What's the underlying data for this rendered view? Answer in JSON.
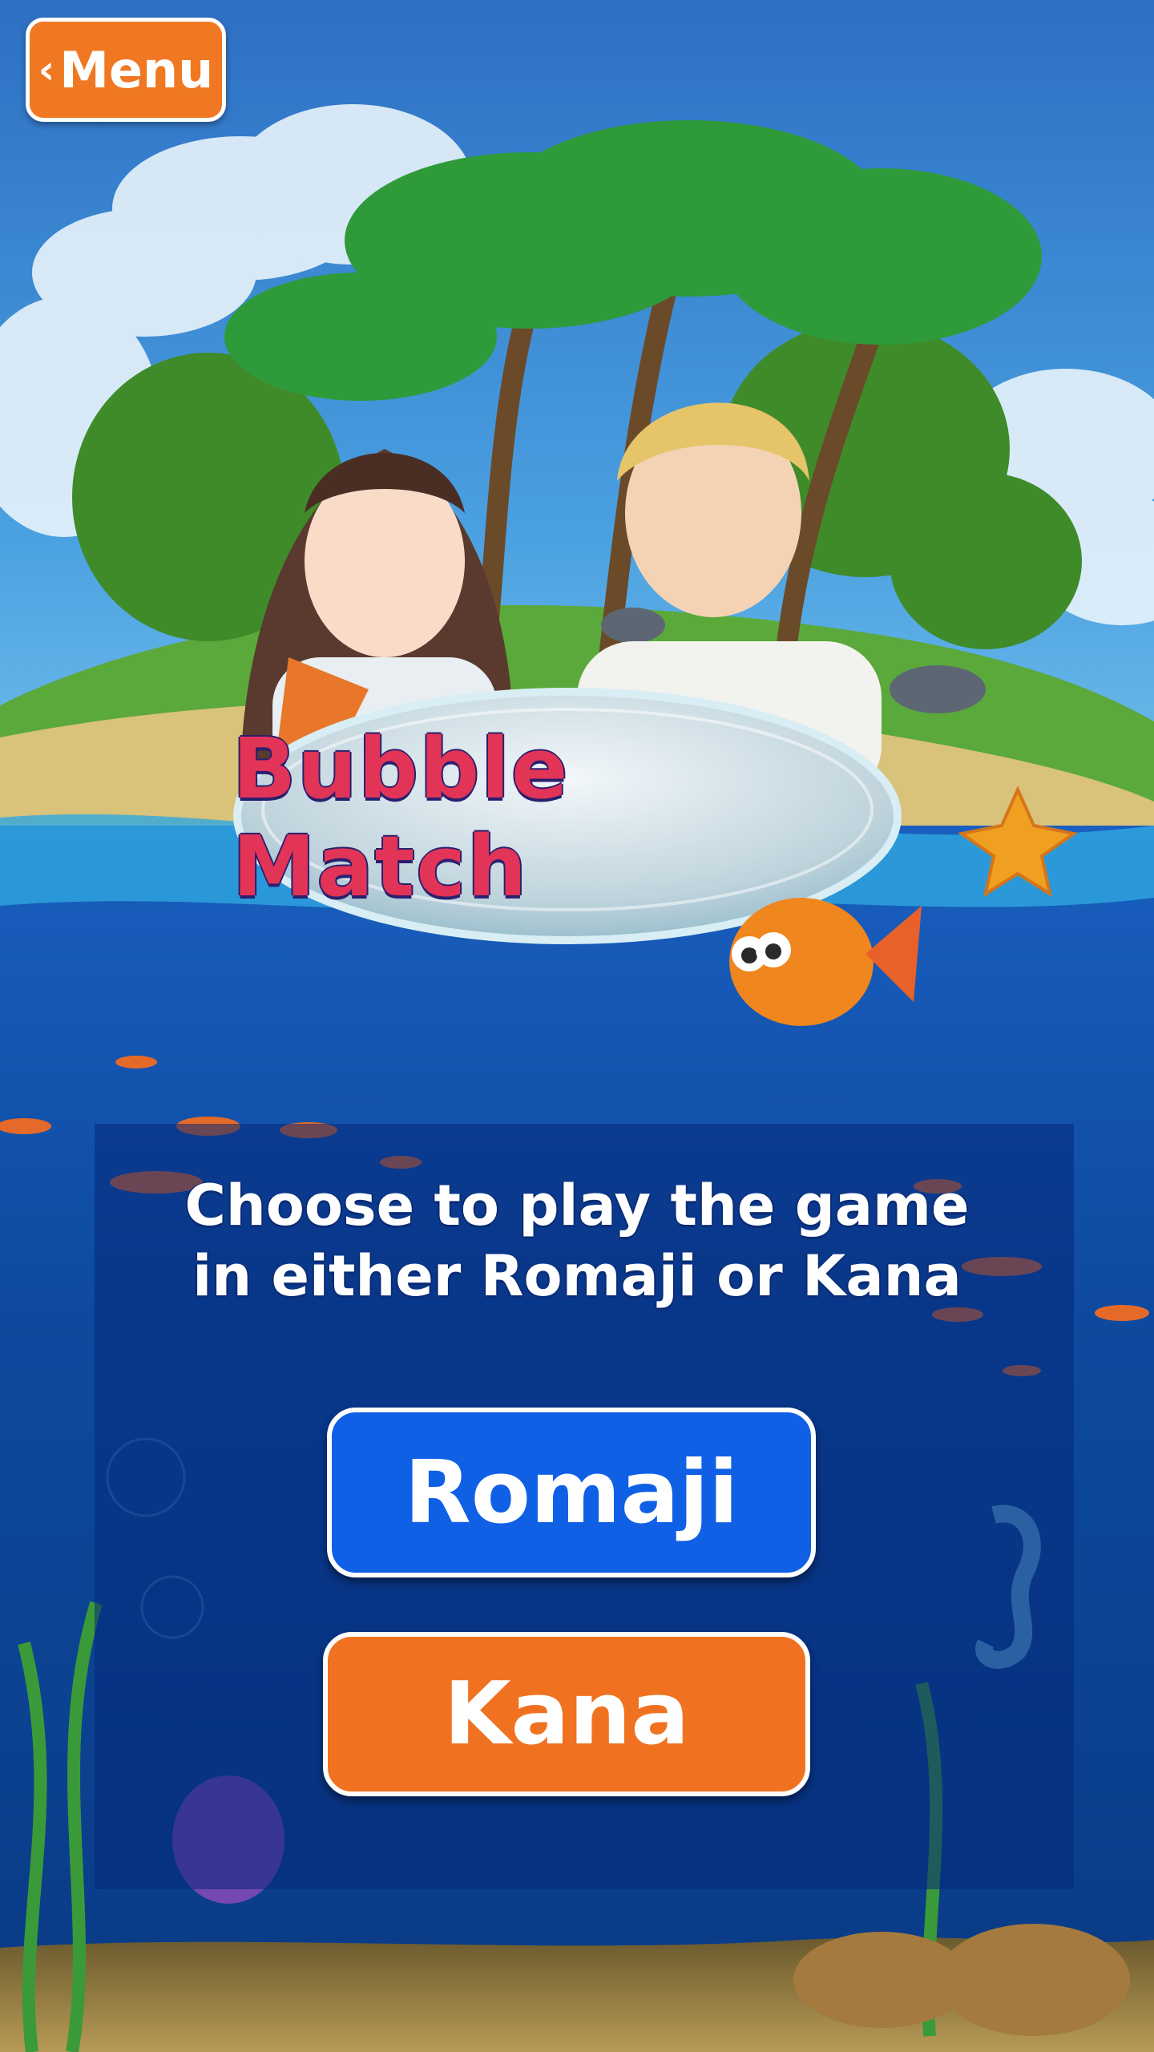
{
  "header": {
    "menu_label": "Menu",
    "menu_icon": "chevron-left-icon"
  },
  "title": {
    "text": "Bubble Match",
    "color": "#e23457"
  },
  "prompt": {
    "line1": "Choose to play the game",
    "line2": "in either Romaji or Kana"
  },
  "choices": {
    "romaji_label": "Romaji",
    "kana_label": "Kana"
  },
  "colors": {
    "primary_blue": "#1060e6",
    "accent_orange": "#f07822",
    "sea": "#0d4a9a"
  }
}
